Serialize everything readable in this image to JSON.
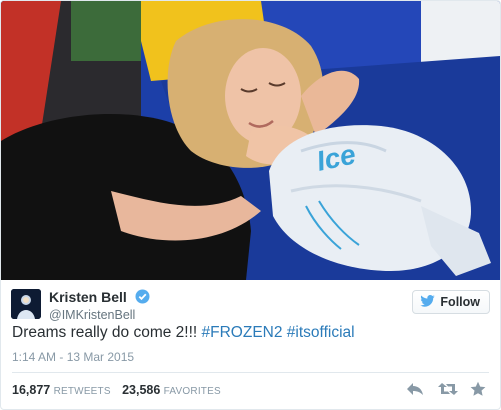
{
  "tweet": {
    "author_name": "Kristen Bell",
    "author_handle": "@IMKristenBell",
    "follow_label": "Follow",
    "text_plain": "Dreams really do come 2!!! ",
    "hashtag_1": "#FROZEN2",
    "hashtag_2": "#itsofficial",
    "timestamp": "1:14 AM - 13 Mar 2015",
    "retweets_count": "16,877",
    "retweets_label": "RETWEETS",
    "favorites_count": "23,586",
    "favorites_label": "FAVORITES",
    "media_ice_bag_text": "Ice"
  },
  "colors": {
    "link": "#2b7bb9",
    "text": "#292f33",
    "muted": "#8899a6",
    "verified": "#55acee",
    "twitter_blue": "#55acee"
  },
  "icons": {
    "verified": "verified-badge-icon",
    "follow": "twitter-bird-icon",
    "reply": "reply-icon",
    "retweet": "retweet-icon",
    "favorite": "star-icon"
  }
}
